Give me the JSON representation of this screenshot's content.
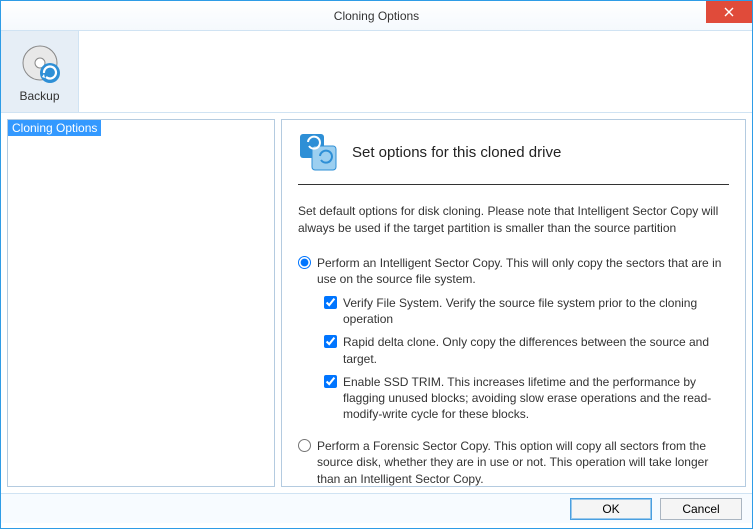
{
  "window": {
    "title": "Cloning Options"
  },
  "toolbar": {
    "backup_label": "Backup"
  },
  "tree": {
    "item0": "Cloning Options"
  },
  "panel": {
    "heading": "Set options for this cloned drive",
    "description": "Set default options for disk cloning.  Please note that Intelligent Sector Copy will always be used if the target partition is smaller than the source partition",
    "radio_intelligent": "Perform an Intelligent Sector Copy.  This will only copy the sectors that are in use on the source file system.",
    "check_verify": "Verify File System.  Verify the source file system prior to the cloning operation",
    "check_rapid": "Rapid delta clone.  Only copy the differences between the source and target.",
    "check_trim": "Enable SSD TRIM. This increases lifetime and the performance by flagging unused blocks; avoiding slow erase operations and the read-modify-write cycle for these blocks.",
    "radio_forensic": "Perform a Forensic Sector Copy. This option will copy all sectors from the source disk, whether they are in use or not.  This operation will take longer than an Intelligent Sector Copy."
  },
  "buttons": {
    "ok": "OK",
    "cancel": "Cancel"
  }
}
